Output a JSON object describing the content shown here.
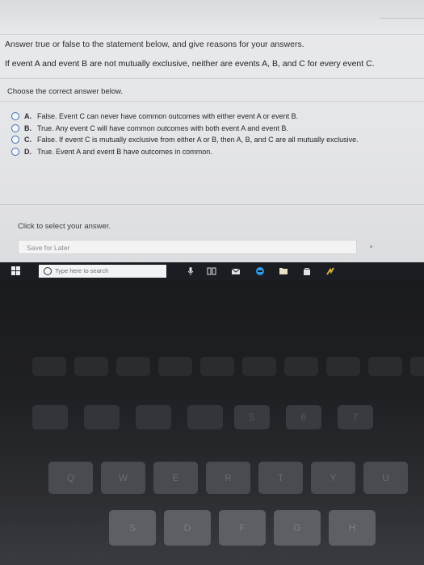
{
  "question": {
    "instruction": "Answer true or false to the statement below, and give reasons for your answers.",
    "statement": "If event A and event B are not mutually exclusive, neither are events A, B, and C for every event C."
  },
  "choose_label": "Choose the correct answer below.",
  "options": [
    {
      "letter": "A.",
      "text": "False. Event C can never have common outcomes with either event A or event B."
    },
    {
      "letter": "B.",
      "text": "True. Any event C will have common outcomes with both event A and event B."
    },
    {
      "letter": "C.",
      "text": "False. If event C is mutually exclusive from either A or B, then A, B, and C are all mutually exclusive."
    },
    {
      "letter": "D.",
      "text": "True. Event A and event B have outcomes in common."
    }
  ],
  "click_message": "Click to select your answer.",
  "save_button": "Save for Later",
  "taskbar": {
    "search_placeholder": "Type here to search",
    "icons": [
      "windows-start-icon",
      "microphone-icon",
      "task-view-icon",
      "mail-icon",
      "edge-icon",
      "file-explorer-icon",
      "store-icon",
      "arrow-app-icon"
    ]
  },
  "keyboard": {
    "row1": [
      "5",
      "6",
      "7"
    ],
    "row2": [
      "Q",
      "W",
      "E",
      "R",
      "T",
      "Y",
      "U"
    ],
    "row3": [
      "S",
      "D",
      "F",
      "G",
      "H"
    ]
  },
  "colors": {
    "radio_border": "#3f6fb0",
    "taskbar_bg": "#1c1d22",
    "edge_blue": "#2b9ae8"
  }
}
